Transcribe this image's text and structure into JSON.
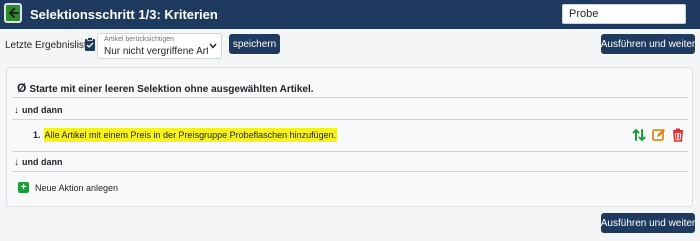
{
  "header": {
    "title": "Selektionsschritt 1/3: Kriterien",
    "search_value": "Probe"
  },
  "toolbar": {
    "last_results_label": "Letzte Ergebnisliste:",
    "article_select": {
      "caption": "Artikel berücksichtigen",
      "value": "Nur nicht vergriffene Artike"
    },
    "save_label": "speichern",
    "run_label": "Ausführen und weiter"
  },
  "criteria": {
    "start_symbol": "Ø",
    "start_text": "Starte mit einer leeren Selektion ohne ausgewählten Artikel.",
    "then_label": "und dann",
    "then_arrow": "↓",
    "actions": [
      {
        "number": "1.",
        "text": "Alle Artikel mit einem Preis in der Preisgruppe Probeflaschen hinzufügen."
      }
    ],
    "add_action_label": "Neue Aktion anlegen",
    "add_symbol": "+"
  },
  "footer": {
    "run_label": "Ausführen und weiter"
  },
  "icons": {
    "back": "arrow-left-icon",
    "clipboard": "clipboard-icon",
    "chevron": "chevron-down-icon",
    "sort": "sort-arrows-icon",
    "edit": "edit-icon",
    "trash": "trash-icon",
    "add": "plus-icon"
  },
  "colors": {
    "header_bg": "#1f3a5f",
    "back_button": "#2d8a2d",
    "highlight": "#f6f21a",
    "sort_icon": "#1e9e3a",
    "edit_icon": "#e07b00",
    "trash_icon": "#d6332e",
    "add_icon": "#1e9e3a"
  }
}
